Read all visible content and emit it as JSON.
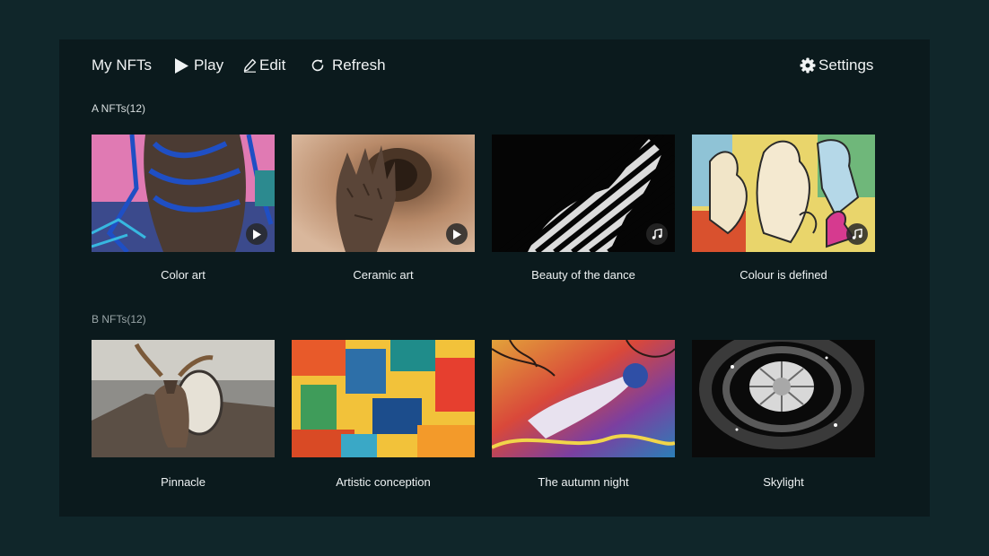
{
  "toolbar": {
    "my_nfts": "My NFTs",
    "play": "Play",
    "edit": "Edit",
    "refresh": "Refresh",
    "settings": "Settings"
  },
  "sections": [
    {
      "title": "A NFTs(12)",
      "items": [
        {
          "title": "Color art",
          "badge": "play-icon"
        },
        {
          "title": "Ceramic art",
          "badge": "play-icon"
        },
        {
          "title": "Beauty of the dance",
          "badge": "music-note-icon"
        },
        {
          "title": "Colour is defined",
          "badge": "music-note-icon"
        }
      ]
    },
    {
      "title": "B NFTs(12)",
      "items": [
        {
          "title": "Pinnacle"
        },
        {
          "title": "Artistic conception"
        },
        {
          "title": "The autumn night"
        },
        {
          "title": "Skylight"
        }
      ]
    }
  ],
  "colors": {
    "outer_bg": "#10262a",
    "panel_bg": "#0b1a1d",
    "text": "#f0f3f4"
  }
}
